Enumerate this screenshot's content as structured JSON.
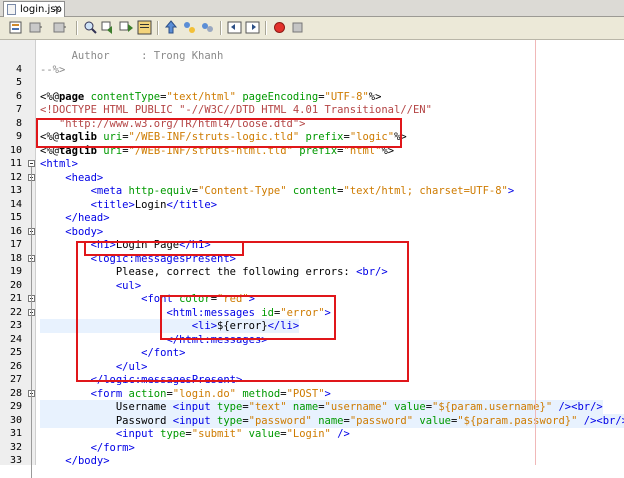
{
  "tab": {
    "label": "login.jsp",
    "close": "×"
  },
  "toolbar": {
    "icons": [
      "source-icon",
      "back-icon",
      "forward-icon",
      "search-prev-icon",
      "search-next-icon",
      "toggle-highlight-icon",
      "toggle-bookmark-icon",
      "prev-bookmark-icon",
      "next-bookmark-icon",
      "shift-left-icon",
      "shift-right-icon",
      "macro-record-icon",
      "macro-stop-icon"
    ]
  },
  "lines": [
    {
      "n": "",
      "text": "     Author     : Trong Khanh"
    },
    {
      "n": "4",
      "text": "--%>"
    },
    {
      "n": "5",
      "text": ""
    },
    {
      "n": "6",
      "text": "<%@page contentType=\"text/html\" pageEncoding=\"UTF-8\"%>"
    },
    {
      "n": "7",
      "text": "<!DOCTYPE HTML PUBLIC \"-//W3C//DTD HTML 4.01 Transitional//EN\""
    },
    {
      "n": "8",
      "text": "   \"http://www.w3.org/TR/html4/loose.dtd\">"
    },
    {
      "n": "9",
      "text": "<%@taglib uri=\"/WEB-INF/struts-logic.tld\" prefix=\"logic\"%>"
    },
    {
      "n": "10",
      "text": "<%@taglib uri=\"/WEB-INF/struts-html.tld\" prefix=\"html\"%>"
    },
    {
      "n": "11",
      "text": "<html>"
    },
    {
      "n": "12",
      "text": "    <head>"
    },
    {
      "n": "13",
      "text": "        <meta http-equiv=\"Content-Type\" content=\"text/html; charset=UTF-8\">"
    },
    {
      "n": "14",
      "text": "        <title>Login</title>"
    },
    {
      "n": "15",
      "text": "    </head>"
    },
    {
      "n": "16",
      "text": "    <body>"
    },
    {
      "n": "17",
      "text": "        <h1>Login Page</h1>"
    },
    {
      "n": "18",
      "text": "        <logic:messagesPresent>"
    },
    {
      "n": "19",
      "text": "            Please, correct the following errors: <br/>"
    },
    {
      "n": "20",
      "text": "            <ul>"
    },
    {
      "n": "21",
      "text": "                <font color=\"red\">"
    },
    {
      "n": "22",
      "text": "                    <html:messages id=\"error\">"
    },
    {
      "n": "23",
      "text": "                        <li>${error}</li>"
    },
    {
      "n": "24",
      "text": "                    </html:messages>"
    },
    {
      "n": "25",
      "text": "                </font>"
    },
    {
      "n": "26",
      "text": "            </ul>"
    },
    {
      "n": "27",
      "text": "        </logic:messagesPresent>"
    },
    {
      "n": "28",
      "text": "        <form action=\"login.do\" method=\"POST\">"
    },
    {
      "n": "29",
      "text": "            Username <input type=\"text\" name=\"username\" value=\"${param.username}\" /><br/>"
    },
    {
      "n": "30",
      "text": "            Password <input type=\"password\" name=\"password\" value=\"${param.password}\" /><br/>"
    },
    {
      "n": "31",
      "text": "            <input type=\"submit\" value=\"Login\" />"
    },
    {
      "n": "32",
      "text": "        </form>"
    },
    {
      "n": "33",
      "text": "    </body>"
    }
  ],
  "colors": {
    "highlight_box": "#e0161a",
    "tag": "#0000e6",
    "attr": "#009900",
    "string": "#ce7b00"
  }
}
